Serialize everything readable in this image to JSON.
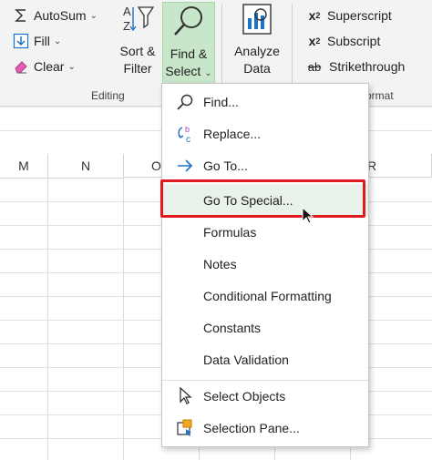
{
  "ribbon": {
    "editing": {
      "autosum_label": "AutoSum",
      "fill_label": "Fill",
      "clear_label": "Clear",
      "sort_filter_line1": "Sort &",
      "sort_filter_line2": "Filter",
      "find_select_line1": "Find &",
      "find_select_line2": "Select",
      "group_label": "Editing"
    },
    "analyze": {
      "line1": "Analyze",
      "line2": "Data"
    },
    "format": {
      "superscript_label": "Superscript",
      "subscript_label": "Subscript",
      "strikethrough_label": "Strikethrough",
      "group_label_partial": "ormat"
    }
  },
  "sheet": {
    "columns": [
      "M",
      "N",
      "O",
      "R"
    ]
  },
  "menu": {
    "items": [
      {
        "label": "Find...",
        "icon": "search-icon"
      },
      {
        "label": "Replace...",
        "icon": "replace-icon"
      },
      {
        "label": "Go To...",
        "icon": "arrow-right-icon"
      },
      {
        "label": "Go To Special...",
        "icon": ""
      },
      {
        "label": "Formulas",
        "icon": ""
      },
      {
        "label": "Notes",
        "icon": ""
      },
      {
        "label": "Conditional Formatting",
        "icon": ""
      },
      {
        "label": "Constants",
        "icon": ""
      },
      {
        "label": "Data Validation",
        "icon": ""
      },
      {
        "label": "Select Objects",
        "icon": "pointer-icon"
      },
      {
        "label": "Selection Pane...",
        "icon": "selection-pane-icon"
      }
    ],
    "highlighted_index": 3
  },
  "colors": {
    "ribbon_bg": "#f3f3f3",
    "active_button": "#c8e6c9",
    "highlight_row": "#e8f1ea",
    "callout_border": "#e0191e",
    "accent_blue": "#1e72c8"
  }
}
